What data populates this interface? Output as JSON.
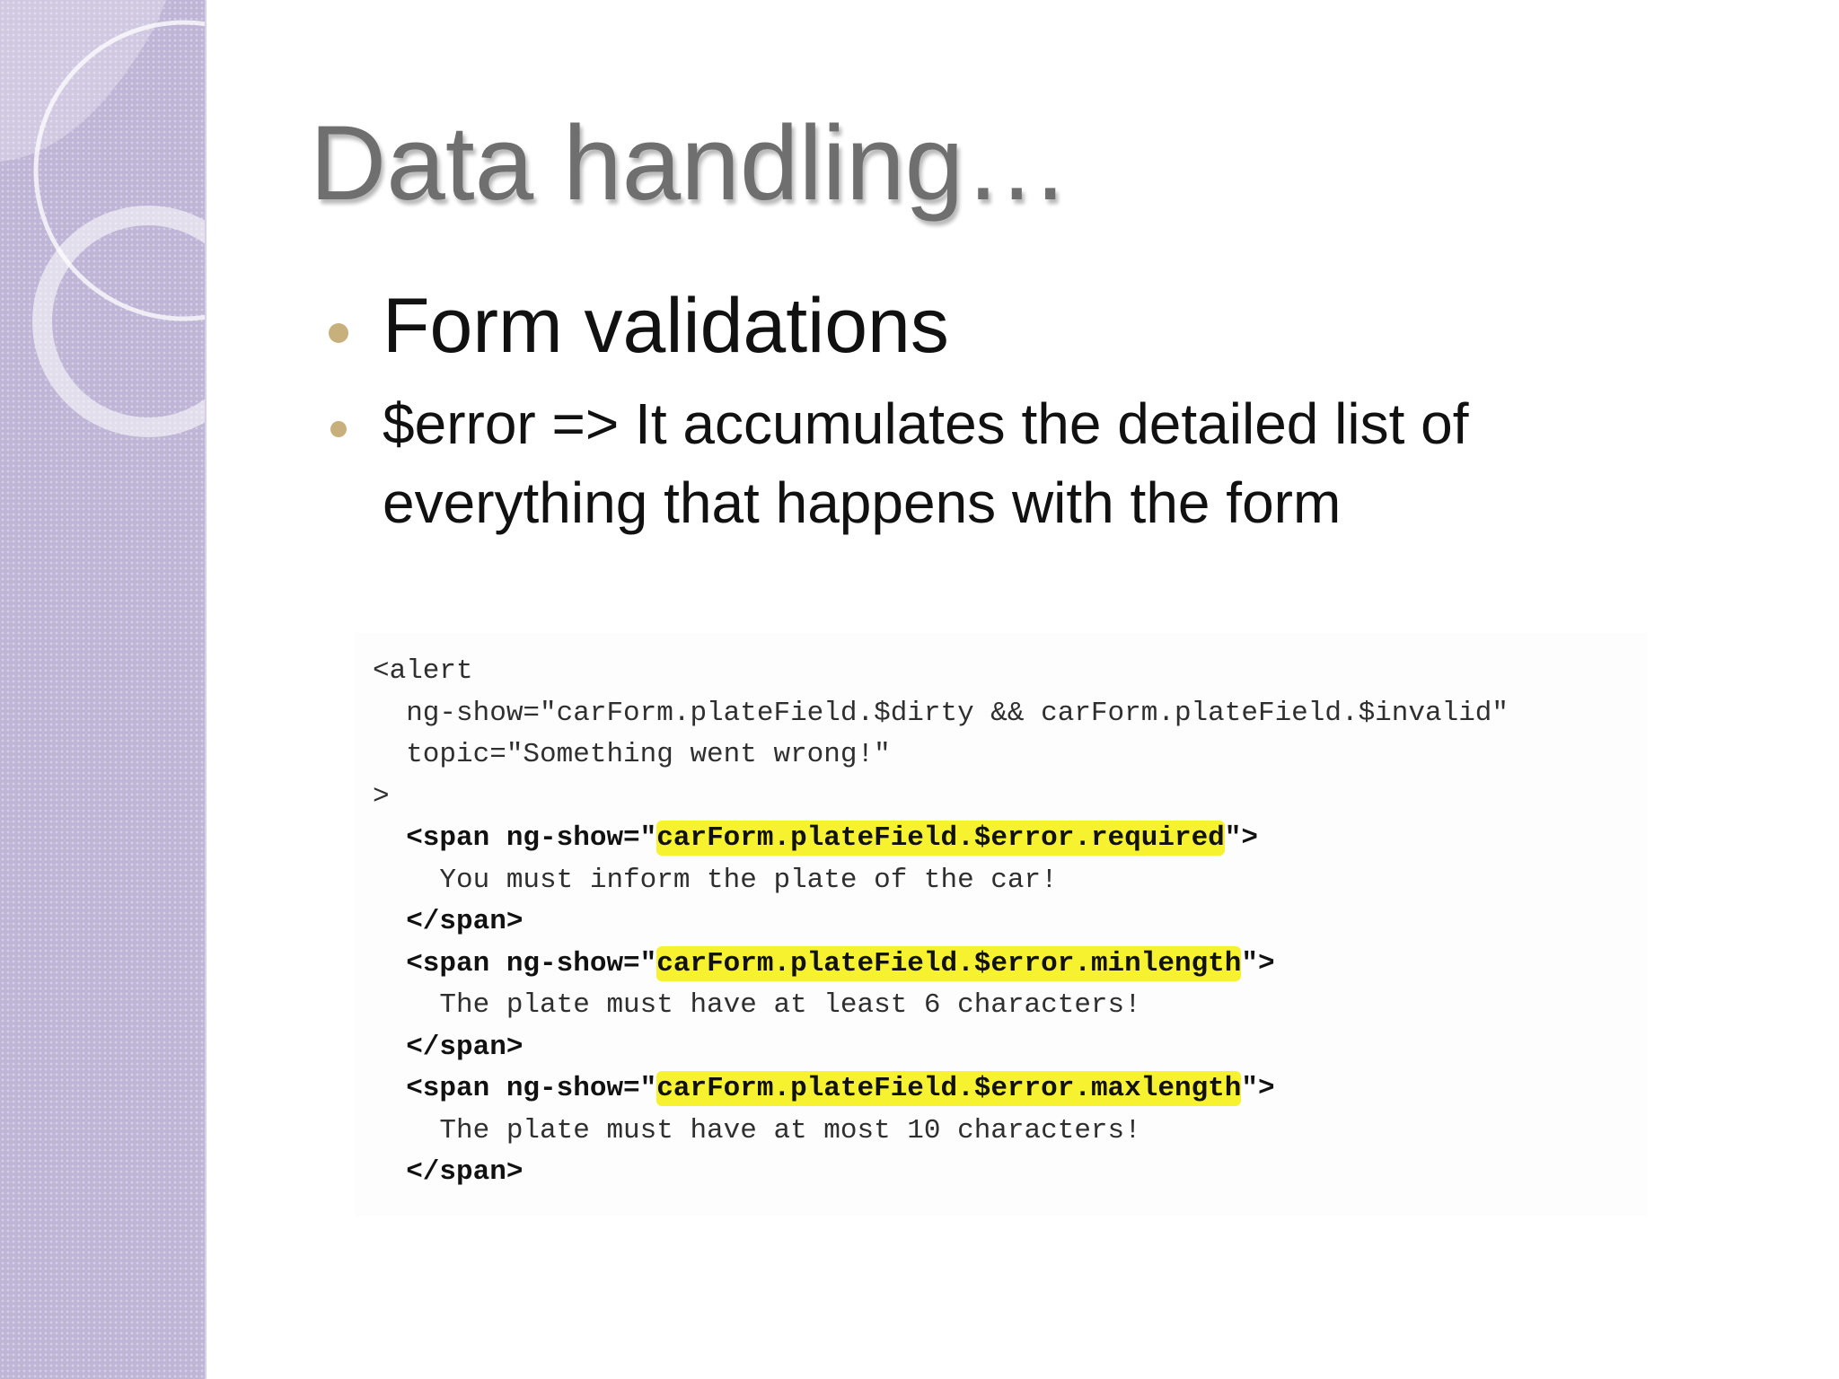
{
  "slide": {
    "title": "Data handling…",
    "bullets": [
      "Form validations",
      "$error => It accumulates the detailed list of everything that happens with the form"
    ],
    "colors": {
      "side_panel": "#bfb5d6",
      "bullet_dot": "#c7b07c",
      "highlight": "#f6f230",
      "title": "#6f6f6f"
    }
  },
  "code": {
    "line1": "<alert",
    "line2": "  ng-show=\"carForm.plateField.$dirty && carForm.plateField.$invalid\"",
    "line3": "  topic=\"Something went wrong!\"",
    "line4": ">",
    "span1_open_prefix": "  <span ng-show=\"",
    "span1_expr": "carForm.plateField.$error.required",
    "span1_open_suffix": "\">",
    "span1_text": "    You must inform the plate of the car!",
    "span1_close": "  </span>",
    "span2_open_prefix": "  <span ng-show=\"",
    "span2_expr": "carForm.plateField.$error.minlength",
    "span2_open_suffix": "\">",
    "span2_text": "    The plate must have at least 6 characters!",
    "span2_close": "  </span>",
    "span3_open_prefix": "  <span ng-show=\"",
    "span3_expr": "carForm.plateField.$error.maxlength",
    "span3_open_suffix": "\">",
    "span3_text": "    The plate must have at most 10 characters!",
    "span3_close": "  </span>"
  }
}
